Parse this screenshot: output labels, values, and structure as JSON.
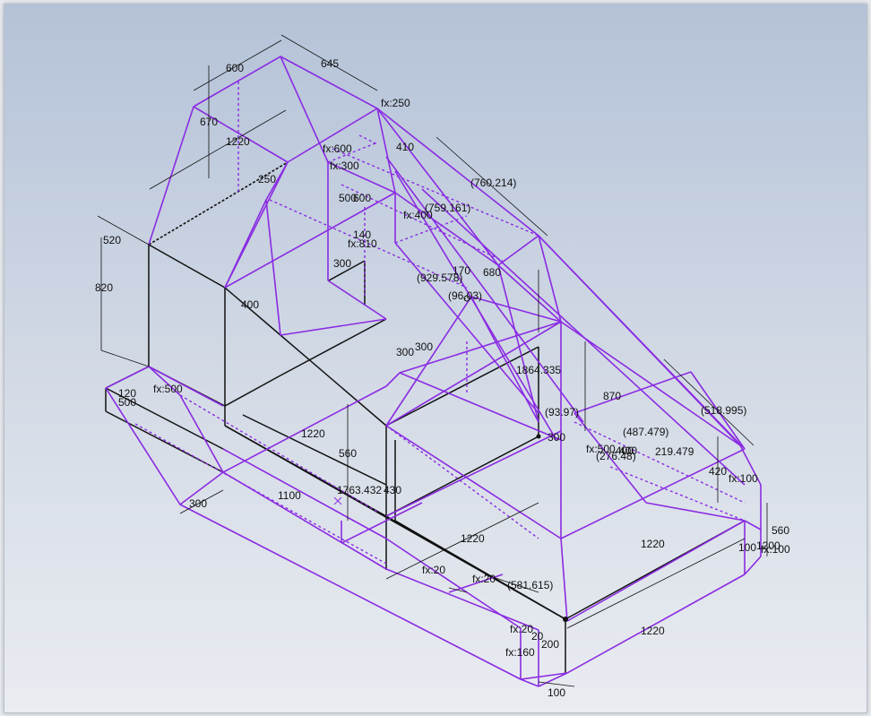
{
  "colors": {
    "sketch_geometry": "#8a2be2",
    "model_edges": "#111111",
    "background_top": "#b4c2d8",
    "background_bottom": "#e9ecf1"
  },
  "dimensions": [
    "600",
    "645",
    "670",
    "1220",
    "fx:250",
    "fx:600",
    "410",
    "fx:300",
    "250",
    "500",
    "600",
    "(760.214)",
    "fx:400",
    "(759.161)",
    "520",
    "140",
    "fx:810",
    "820",
    "300",
    "170",
    "680",
    "(929.578)",
    "(96.03)",
    "400",
    "300",
    "300",
    "1864.335",
    "120",
    "fx:500",
    "500",
    "870",
    "(93.97)",
    "(487.479)",
    "(518.995)",
    "1220",
    "560",
    "fx:500",
    "400",
    "(276.48)",
    "219.479",
    "300",
    "420",
    "fx:100",
    "1100",
    "1763.432",
    "430",
    "400",
    "560",
    "1200",
    "1220",
    "fx:20",
    "1220",
    "fx:20",
    "(581.615)",
    "fx:20",
    "fx:160",
    "200",
    "1220",
    "100",
    "100",
    "fx:100",
    "20"
  ]
}
